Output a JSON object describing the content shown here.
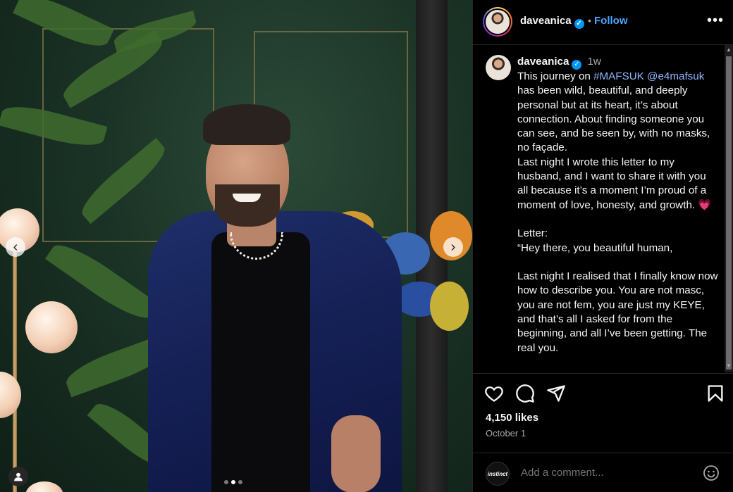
{
  "post": {
    "username": "daveanica",
    "follow_label": "Follow",
    "separator": "•",
    "more_label": "•••",
    "time_ago": "1w",
    "caption": [
      {
        "type": "text",
        "value": "This journey on "
      },
      {
        "type": "tag",
        "value": "#MAFSUK"
      },
      {
        "type": "text",
        "value": " "
      },
      {
        "type": "tag",
        "value": "@e4mafsuk"
      },
      {
        "type": "text",
        "value": " has been wild, beautiful, and deeply personal but at its heart, it’s about connection. About finding someone you can see, and be seen by, with no masks, no façade.\nLast night I wrote this letter to my husband, and I want to share it with you all because it’s a moment I’m proud of a moment of love, honesty, and growth. "
      },
      {
        "type": "emoji",
        "value": "💗"
      },
      {
        "type": "text",
        "value": "\n\nLetter:\n“Hey there, you beautiful human,\n\nLast night I realised that I finally know now how to describe you. You are not masc, you are not fem, you are just my KEYE, and that’s all I asked for from the beginning, and all I’ve been getting. The real you."
      }
    ],
    "likes": "4,150 likes",
    "date": "October 1",
    "carousel": {
      "current": 1,
      "total": 3
    }
  },
  "comment": {
    "placeholder": "Add a comment...",
    "avatar_text": "instinct"
  },
  "colors": {
    "follow": "#4ca6ff",
    "link": "#8fb6ff",
    "verified": "#0095f6",
    "background": "#000000"
  },
  "icons": {
    "verified": "verified-badge-icon",
    "like": "heart-icon",
    "comment": "comment-icon",
    "share": "send-icon",
    "save": "bookmark-icon",
    "emoji": "smiley-icon",
    "prev": "chevron-left-icon",
    "next": "chevron-right-icon",
    "tags": "user-tag-icon"
  }
}
